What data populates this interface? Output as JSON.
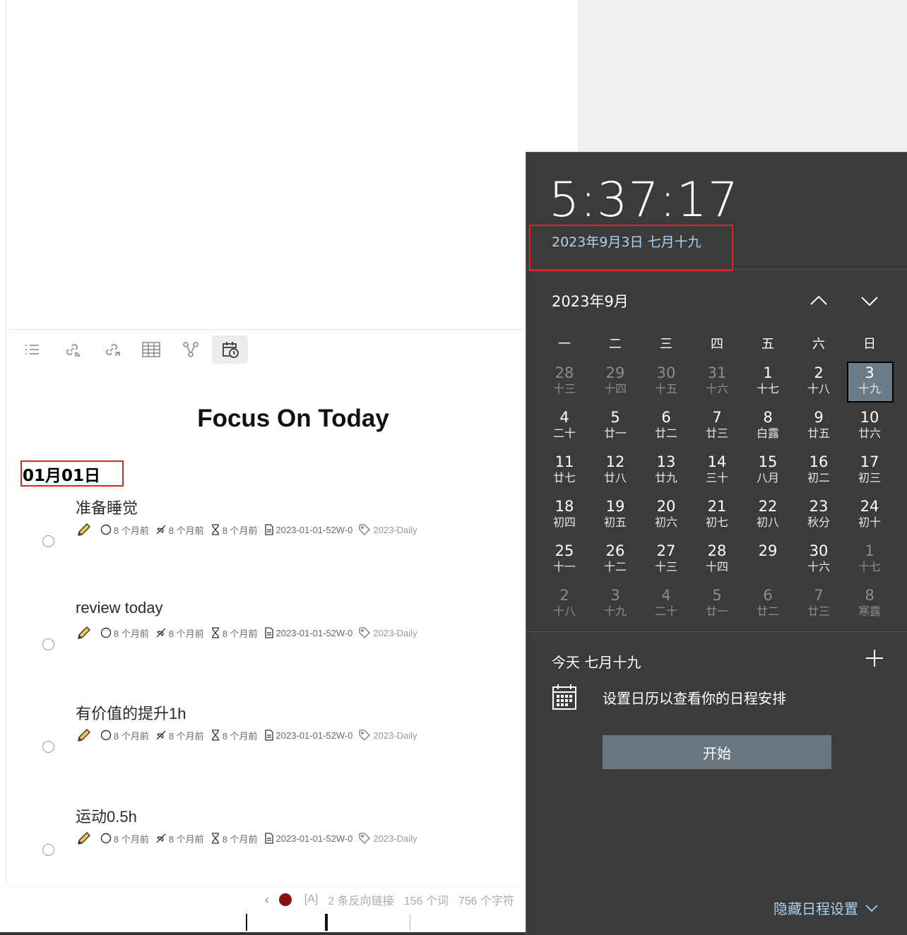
{
  "editor": {
    "title": "Focus On Today",
    "date_heading": "01月01日",
    "toolbar": [
      "outline",
      "backlinks",
      "outgoing-links",
      "table",
      "graph",
      "calendar-clock"
    ],
    "tasks": [
      {
        "title": "准备睡觉",
        "meta": [
          "8 个月前",
          "8 个月前",
          "8 个月前",
          "2023-01-01-52W-0",
          "2023-Daily"
        ]
      },
      {
        "title": "review today",
        "meta": [
          "8 个月前",
          "8 个月前",
          "8 个月前",
          "2023-01-01-52W-0",
          "2023-Daily"
        ]
      },
      {
        "title": "有价值的提升1h",
        "meta": [
          "8 个月前",
          "8 个月前",
          "8 个月前",
          "2023-01-01-52W-0",
          "2023-Daily"
        ]
      },
      {
        "title": "运动0.5h",
        "meta": [
          "8 个月前",
          "8 个月前",
          "8 个月前",
          "2023-01-01-52W-0",
          "2023-Daily"
        ]
      }
    ],
    "status": {
      "mode": "[A]",
      "backlinks": "2 条反向链接",
      "words": "156 个词",
      "chars": "756 个字符"
    }
  },
  "flyout": {
    "time": "5:37:17",
    "full_date": "2023年9月3日 七月十九",
    "month": "2023年9月",
    "weekdays": [
      "一",
      "二",
      "三",
      "四",
      "五",
      "六",
      "日"
    ],
    "weeks": [
      [
        {
          "d": "28",
          "l": "十三",
          "o": true
        },
        {
          "d": "29",
          "l": "十四",
          "o": true
        },
        {
          "d": "30",
          "l": "十五",
          "o": true
        },
        {
          "d": "31",
          "l": "十六",
          "o": true
        },
        {
          "d": "1",
          "l": "十七"
        },
        {
          "d": "2",
          "l": "十八"
        },
        {
          "d": "3",
          "l": "十九",
          "t": true
        }
      ],
      [
        {
          "d": "4",
          "l": "二十"
        },
        {
          "d": "5",
          "l": "廿一"
        },
        {
          "d": "6",
          "l": "廿二"
        },
        {
          "d": "7",
          "l": "廿三"
        },
        {
          "d": "8",
          "l": "白露"
        },
        {
          "d": "9",
          "l": "廿五"
        },
        {
          "d": "10",
          "l": "廿六"
        }
      ],
      [
        {
          "d": "11",
          "l": "廿七"
        },
        {
          "d": "12",
          "l": "廿八"
        },
        {
          "d": "13",
          "l": "廿九"
        },
        {
          "d": "14",
          "l": "三十"
        },
        {
          "d": "15",
          "l": "八月"
        },
        {
          "d": "16",
          "l": "初二"
        },
        {
          "d": "17",
          "l": "初三"
        }
      ],
      [
        {
          "d": "18",
          "l": "初四"
        },
        {
          "d": "19",
          "l": "初五"
        },
        {
          "d": "20",
          "l": "初六"
        },
        {
          "d": "21",
          "l": "初七"
        },
        {
          "d": "22",
          "l": "初八"
        },
        {
          "d": "23",
          "l": "秋分"
        },
        {
          "d": "24",
          "l": "初十"
        }
      ],
      [
        {
          "d": "25",
          "l": "十一"
        },
        {
          "d": "26",
          "l": "十二"
        },
        {
          "d": "27",
          "l": "十三"
        },
        {
          "d": "28",
          "l": "十四"
        },
        {
          "d": "29",
          "l": ""
        },
        {
          "d": "30",
          "l": "十六"
        },
        {
          "d": "1",
          "l": "十七",
          "o": true
        }
      ],
      [
        {
          "d": "2",
          "l": "十八",
          "o": true
        },
        {
          "d": "3",
          "l": "十九",
          "o": true
        },
        {
          "d": "4",
          "l": "二十",
          "o": true
        },
        {
          "d": "5",
          "l": "廿一",
          "o": true
        },
        {
          "d": "6",
          "l": "廿二",
          "o": true
        },
        {
          "d": "7",
          "l": "廿三",
          "o": true
        },
        {
          "d": "8",
          "l": "寒露",
          "o": true
        }
      ]
    ],
    "today_label": "今天 七月十九",
    "schedule_msg": "设置日历以查看你的日程安排",
    "start_label": "开始",
    "hide_settings": "隐藏日程设置"
  },
  "colors": {
    "accent_text": "#a9d2f0",
    "today_fill": "#6a7c89",
    "highlight_box": "#e02424",
    "status_dot": "#8b0f0f"
  }
}
